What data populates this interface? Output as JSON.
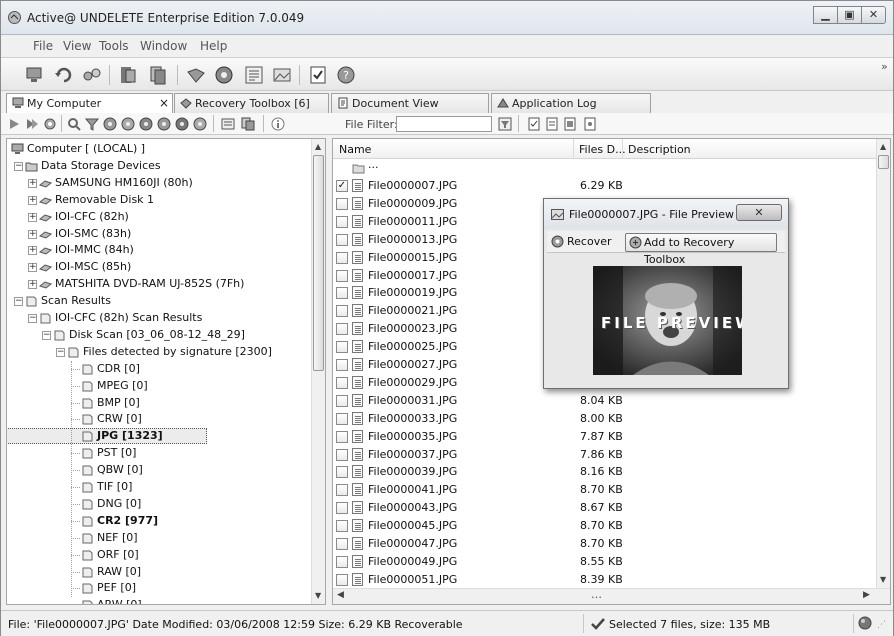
{
  "window": {
    "title": "Active@ UNDELETE Enterprise Edition 7.0.049",
    "controls": [
      "minimize-icon",
      "maximize-icon",
      "close-icon"
    ]
  },
  "menu": [
    "File",
    "View",
    "Tools",
    "Window",
    "Help"
  ],
  "toolbar_overflow": "»",
  "tabs": [
    {
      "label": "My Computer",
      "icon": "computer-icon",
      "close": "×"
    },
    {
      "label": "Recovery Toolbox [6]",
      "icon": "toolbox-icon"
    },
    {
      "label": "Document View",
      "icon": "document-icon"
    },
    {
      "label": "Application Log",
      "icon": "log-icon"
    }
  ],
  "file_filter": {
    "label": "File Filter:",
    "value": ""
  },
  "tree": [
    {
      "label": "Computer [ (LOCAL) ]"
    },
    {
      "label": "Data Storage Devices",
      "expander": "−"
    },
    {
      "label": "SAMSUNG HM160JI (80h)",
      "expander": "+"
    },
    {
      "label": "Removable Disk 1",
      "expander": "+"
    },
    {
      "label": "IOI-CFC (82h)",
      "expander": "+"
    },
    {
      "label": "IOI-SMC (83h)",
      "expander": "+"
    },
    {
      "label": "IOI-MMC (84h)",
      "expander": "+"
    },
    {
      "label": "IOI-MSC (85h)",
      "expander": "+"
    },
    {
      "label": "MATSHITA DVD-RAM UJ-852S (7Fh)",
      "expander": "+"
    },
    {
      "label": "Scan Results",
      "expander": "−"
    },
    {
      "label": "IOI-CFC (82h) Scan Results",
      "expander": "−"
    },
    {
      "label": "Disk Scan [03_06_08-12_48_29]",
      "expander": "−"
    },
    {
      "label": "Files detected by signature [2300]",
      "expander": "−"
    },
    {
      "label": "CDR [0]"
    },
    {
      "label": "MPEG [0]"
    },
    {
      "label": "BMP [0]"
    },
    {
      "label": "CRW [0]"
    },
    {
      "label": "JPG [1323]",
      "bold": true,
      "selected": true
    },
    {
      "label": "PST [0]"
    },
    {
      "label": "QBW [0]"
    },
    {
      "label": "TIF [0]"
    },
    {
      "label": "DNG [0]"
    },
    {
      "label": "CR2 [977]",
      "bold": true
    },
    {
      "label": "NEF [0]"
    },
    {
      "label": "ORF [0]"
    },
    {
      "label": "RAW [0]"
    },
    {
      "label": "PEF [0]"
    },
    {
      "label": "ARW [0]"
    }
  ],
  "columns": {
    "name": "Name",
    "size": "Files D...",
    "description": "Description"
  },
  "parent_row": "...",
  "files": [
    {
      "name": "File0000007.JPG",
      "size": "6.29 KB",
      "checked": true
    },
    {
      "name": "File0000009.JPG",
      "size": "",
      "checked": false
    },
    {
      "name": "File0000011.JPG",
      "size": "",
      "checked": false
    },
    {
      "name": "File0000013.JPG",
      "size": "",
      "checked": false
    },
    {
      "name": "File0000015.JPG",
      "size": "",
      "checked": false
    },
    {
      "name": "File0000017.JPG",
      "size": "",
      "checked": false
    },
    {
      "name": "File0000019.JPG",
      "size": "",
      "checked": false
    },
    {
      "name": "File0000021.JPG",
      "size": "",
      "checked": false
    },
    {
      "name": "File0000023.JPG",
      "size": "",
      "checked": false
    },
    {
      "name": "File0000025.JPG",
      "size": "",
      "checked": false
    },
    {
      "name": "File0000027.JPG",
      "size": "",
      "checked": false
    },
    {
      "name": "File0000029.JPG",
      "size": "",
      "checked": false
    },
    {
      "name": "File0000031.JPG",
      "size": "8.04 KB",
      "checked": false
    },
    {
      "name": "File0000033.JPG",
      "size": "8.00 KB",
      "checked": false
    },
    {
      "name": "File0000035.JPG",
      "size": "7.87 KB",
      "checked": false
    },
    {
      "name": "File0000037.JPG",
      "size": "7.86 KB",
      "checked": false
    },
    {
      "name": "File0000039.JPG",
      "size": "8.16 KB",
      "checked": false
    },
    {
      "name": "File0000041.JPG",
      "size": "8.70 KB",
      "checked": false
    },
    {
      "name": "File0000043.JPG",
      "size": "8.67 KB",
      "checked": false
    },
    {
      "name": "File0000045.JPG",
      "size": "8.70 KB",
      "checked": false
    },
    {
      "name": "File0000047.JPG",
      "size": "8.70 KB",
      "checked": false
    },
    {
      "name": "File0000049.JPG",
      "size": "8.55 KB",
      "checked": false
    },
    {
      "name": "File0000051.JPG",
      "size": "8.39 KB",
      "checked": false
    }
  ],
  "preview": {
    "title": "File0000007.JPG - File Preview",
    "recover": "Recover",
    "add_to_toolbox": "Add to Recovery Toolbox",
    "image_text": "FILE PREVIEW"
  },
  "status": {
    "info": "File: 'File0000007.JPG'  Date Modified: 03/06/2008 12:59  Size: 6.29 KB  Recoverable",
    "selection": "Selected 7 files, size: 135 MB"
  }
}
